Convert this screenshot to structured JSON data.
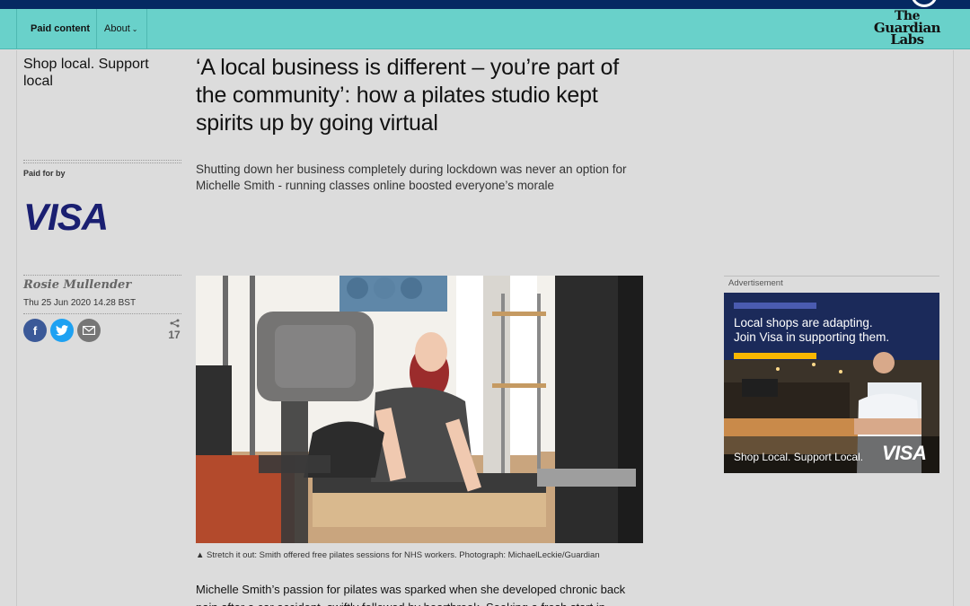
{
  "header": {
    "paid_content": "Paid content",
    "about": "About",
    "logo_lines": [
      "The",
      "Guardian",
      "Labs"
    ]
  },
  "sidebar": {
    "series_title": "Shop local. Support local",
    "paid_for_label": "Paid for by",
    "sponsor_logo": "VISA",
    "author": "Rosie Mullender",
    "date": "Thu 25 Jun 2020 14.28 BST",
    "share_count": "17",
    "share_icons": [
      "facebook-icon",
      "twitter-icon",
      "email-icon"
    ]
  },
  "article": {
    "headline": "‘A local business is different – you’re part of the community’: how a pilates studio kept spirits up by going virtual",
    "standfirst": "Shutting down her business completely during lockdown was never an option for Michelle Smith - running classes online boosted everyone’s morale",
    "caption": "▲ Stretch it out: Smith offered free pilates sessions for NHS workers. Photograph: MichaelLeckie/Guardian",
    "body": "Michelle Smith’s passion for pilates was sparked when she developed chronic back pain after a car accident, swiftly followed by heartbreak. Seeking a fresh start in Australia"
  },
  "advert": {
    "label": "Advertisement",
    "headline_lines": [
      "Local shops are adapting.",
      "Join Visa in supporting them."
    ],
    "footer": "Shop Local. Support Local.",
    "logo": "VISA"
  },
  "colors": {
    "labs_teal": "#69d1ca",
    "guardian_navy": "#052962",
    "visa_blue": "#1a1f71",
    "facebook": "#3b5998",
    "twitter": "#1da1f2",
    "email": "#767676"
  }
}
